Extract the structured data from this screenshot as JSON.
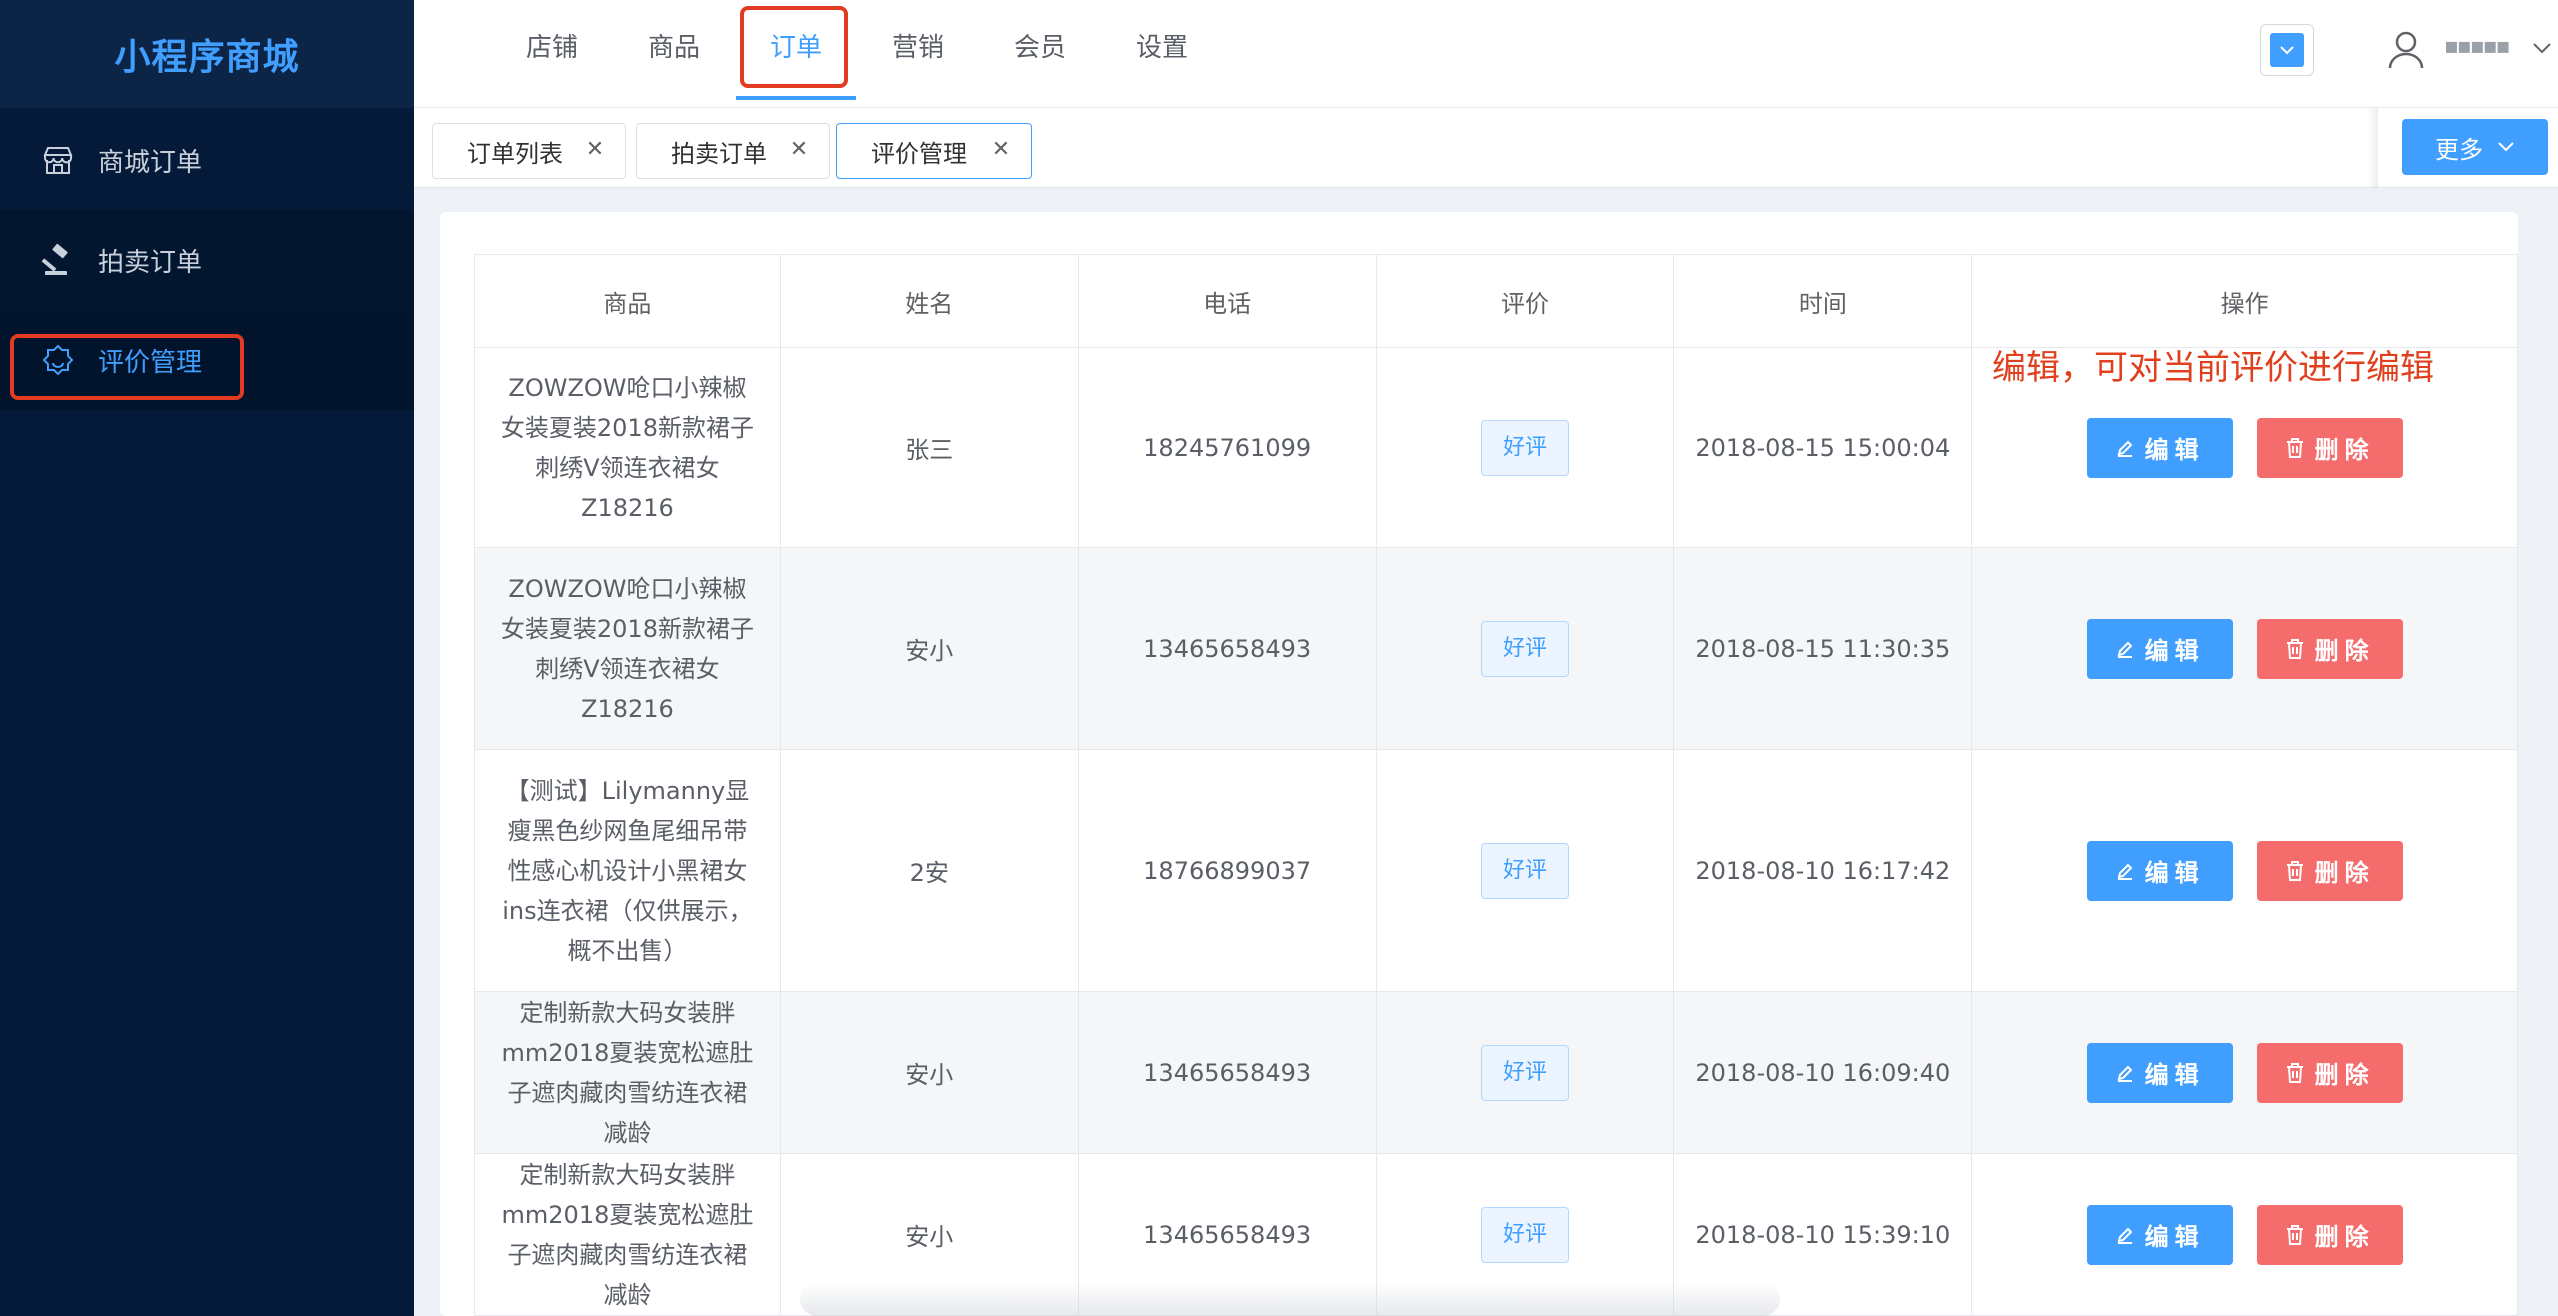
{
  "brand": "小程序商城",
  "sidebar": {
    "items": [
      {
        "label": "商城订单",
        "icon": "store-icon"
      },
      {
        "label": "拍卖订单",
        "icon": "gavel-icon"
      },
      {
        "label": "评价管理",
        "icon": "badge-icon",
        "active": true
      }
    ]
  },
  "topnav": {
    "tabs": [
      "店铺",
      "商品",
      "订单",
      "营销",
      "会员",
      "设置"
    ],
    "active": "订单"
  },
  "user": {
    "name": "▪▪▪▪▪"
  },
  "open_tabs": [
    "订单列表",
    "拍卖订单",
    "评价管理"
  ],
  "more_label": "更多",
  "table": {
    "headers": [
      "商品",
      "姓名",
      "电话",
      "评价",
      "时间",
      "操作"
    ],
    "edit_label": "编辑",
    "delete_label": "删除",
    "rows": [
      {
        "product": "ZOWZOW呛口小辣椒女装夏装2018新款裙子刺绣V领连衣裙女Z18216",
        "name": "张三",
        "phone": "18245761099",
        "rating": "好评",
        "time": "2018-08-15 15:00:04"
      },
      {
        "product": "ZOWZOW呛口小辣椒女装夏装2018新款裙子刺绣V领连衣裙女Z18216",
        "name": "安小",
        "phone": "13465658493",
        "rating": "好评",
        "time": "2018-08-15 11:30:35"
      },
      {
        "product": "【测试】Lilymanny显瘦黑色纱网鱼尾细吊带性感心机设计小黑裙女ins连衣裙（仅供展示，概不出售）",
        "name": "2安",
        "phone": "18766899037",
        "rating": "好评",
        "time": "2018-08-10 16:17:42"
      },
      {
        "product": "定制新款大码女装胖mm2018夏装宽松遮肚子遮肉藏肉雪纺连衣裙减龄",
        "name": "安小",
        "phone": "13465658493",
        "rating": "好评",
        "time": "2018-08-10 16:09:40"
      },
      {
        "product": "定制新款大码女装胖mm2018夏装宽松遮肚子遮肉藏肉雪纺连衣裙减龄",
        "name": "安小",
        "phone": "13465658493",
        "rating": "好评",
        "time": "2018-08-10 15:39:10"
      }
    ]
  },
  "annotation": "编辑，可对当前评价进行编辑",
  "colors": {
    "accent": "#409eff",
    "danger": "#f56c6c",
    "sidebar": "#041a38",
    "highlight": "#e33b22"
  }
}
